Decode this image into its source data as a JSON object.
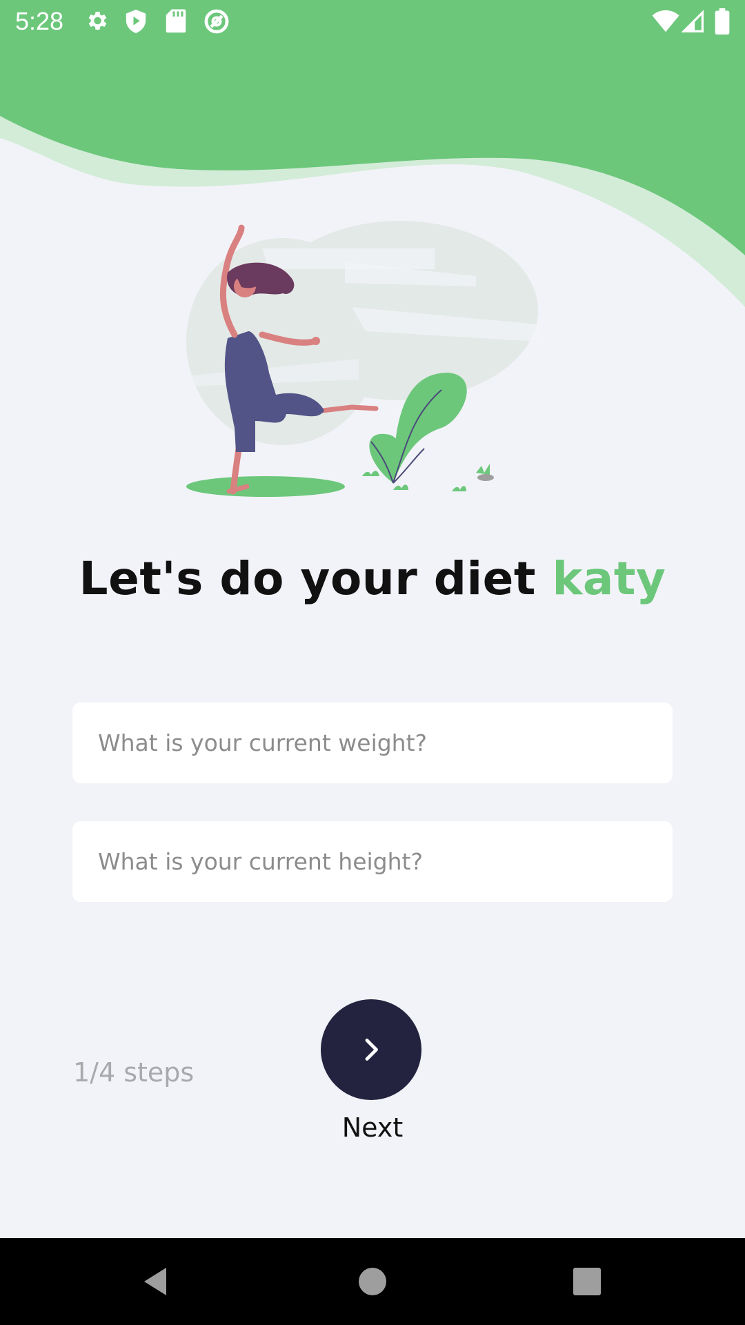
{
  "status_bar": {
    "time": "5:28",
    "left_icons": [
      "gear-icon",
      "shield-play-icon",
      "sd-card-icon",
      "at-sign-icon"
    ],
    "right_icons": [
      "wifi-icon",
      "cell-signal-icon",
      "battery-icon"
    ]
  },
  "colors": {
    "accent_green": "#6cc77b",
    "background": "#f2f3f8",
    "button_dark": "#23233f"
  },
  "greeting": {
    "prefix": "Let's do your diet ",
    "name": "katy"
  },
  "form": {
    "weight_placeholder": "What is your current weight?",
    "height_placeholder": "What is your current height?"
  },
  "progress": {
    "steps_label": "1/4 steps",
    "current_step": 1,
    "total_steps": 4
  },
  "next_button": {
    "icon": "chevron-right-icon",
    "label": "Next"
  },
  "nav_bar": {
    "buttons": [
      "back-triangle-icon",
      "home-circle-icon",
      "recents-square-icon"
    ]
  }
}
